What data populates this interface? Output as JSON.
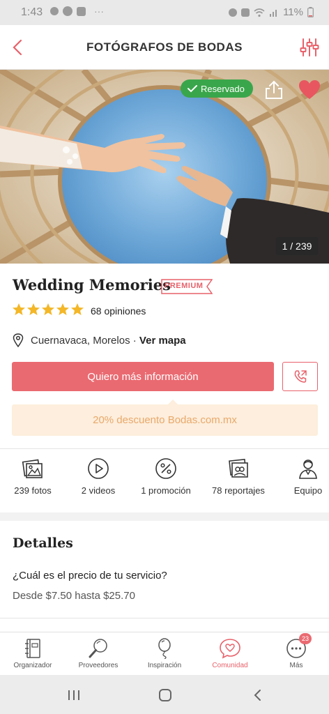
{
  "status_bar": {
    "time": "1:43",
    "battery": "11%"
  },
  "header": {
    "title": "FOTÓGRAFOS DE BODAS",
    "back_icon": "chevron-left-icon",
    "filter_icon": "sliders-icon"
  },
  "hero": {
    "badge": "Reservado",
    "counter": "1 / 239"
  },
  "vendor": {
    "name": "Wedding Memories",
    "tier": "PREMIUM",
    "rating": 5,
    "reviews": "68 opiniones",
    "location": "Cuernavaca, Morelos",
    "separator": " · ",
    "map_link": "Ver mapa"
  },
  "actions": {
    "cta": "Quiero más información"
  },
  "promo": {
    "text": "20% descuento Bodas.com.mx"
  },
  "stats": [
    {
      "label": "239 fotos",
      "icon": "photos-icon"
    },
    {
      "label": "2 videos",
      "icon": "play-icon"
    },
    {
      "label": "1 promoción",
      "icon": "percent-icon"
    },
    {
      "label": "78 reportajes",
      "icon": "albums-icon"
    },
    {
      "label": "Equipo",
      "icon": "team-icon"
    }
  ],
  "details": {
    "title": "Detalles",
    "question": "¿Cuál es el precio de tu servicio?",
    "answer": "Desde $7.50 hasta $25.70"
  },
  "bottom_nav": [
    {
      "label": "Organizador",
      "icon": "notebook-icon"
    },
    {
      "label": "Proveedores",
      "icon": "search-icon"
    },
    {
      "label": "Inspiración",
      "icon": "balloon-icon"
    },
    {
      "label": "Comunidad",
      "icon": "chat-heart-icon",
      "active": true
    },
    {
      "label": "Más",
      "icon": "more-icon",
      "badge": "23"
    }
  ],
  "colors": {
    "accent": "#ea6a71",
    "success": "#3aa64b",
    "promo_bg": "#fdeedd",
    "promo_text": "#e9a86a",
    "star": "#f3b728"
  }
}
